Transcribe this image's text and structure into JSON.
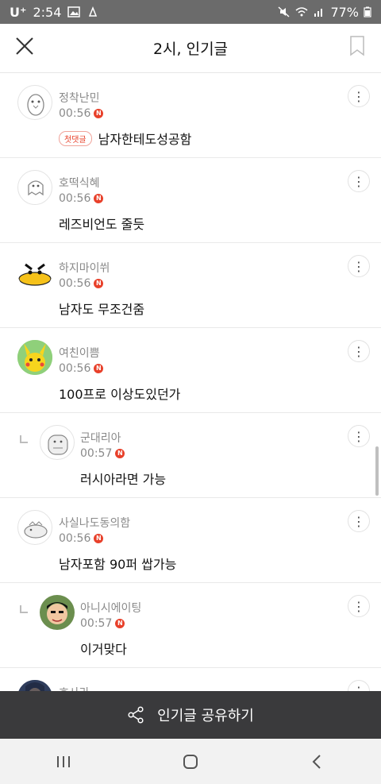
{
  "status_bar": {
    "carrier": "U⁺",
    "time": "2:54",
    "battery": "77%"
  },
  "header": {
    "title": "2시, 인기글",
    "close_icon": "close-icon",
    "bookmark_icon": "bookmark-icon"
  },
  "comments": [
    {
      "nick": "정착난민",
      "time": "00:56",
      "new_badge": "N",
      "tag": "첫댓글",
      "text": "남자한테도성공함",
      "reply": false,
      "avatar": "penguin-avatar"
    },
    {
      "nick": "호떡식혜",
      "time": "00:56",
      "new_badge": "N",
      "tag": "",
      "text": "레즈비언도 줄듯",
      "reply": false,
      "avatar": "ghost-avatar"
    },
    {
      "nick": "하지마이쒸",
      "time": "00:56",
      "new_badge": "N",
      "tag": "",
      "text": "남자도 무조건줌",
      "reply": false,
      "avatar": "duck-avatar"
    },
    {
      "nick": "여친이쁨",
      "time": "00:56",
      "new_badge": "N",
      "tag": "",
      "text": "100프로 이상도있던가",
      "reply": false,
      "avatar": "pikachu-avatar"
    },
    {
      "nick": "군대리아",
      "time": "00:57",
      "new_badge": "N",
      "tag": "",
      "text": "러시아라면 가능",
      "reply": true,
      "avatar": "hippo-avatar"
    },
    {
      "nick": "사실나도동의함",
      "time": "00:56",
      "new_badge": "N",
      "tag": "",
      "text": "남자포함 90퍼 쌉가능",
      "reply": false,
      "avatar": "creature-avatar"
    },
    {
      "nick": "아니시에이팅",
      "time": "00:57",
      "new_badge": "N",
      "tag": "",
      "text": "이거맞다",
      "reply": true,
      "avatar": "person-avatar"
    },
    {
      "nick": "호사라",
      "time": "",
      "new_badge": "",
      "tag": "",
      "text": "",
      "reply": false,
      "avatar": "photo-avatar"
    }
  ],
  "share_bar": {
    "label": "인기글 공유하기",
    "icon": "share-icon"
  },
  "nav_bar": {
    "recent_icon": "recent-apps-icon",
    "home_icon": "home-icon",
    "back_icon": "back-icon"
  }
}
